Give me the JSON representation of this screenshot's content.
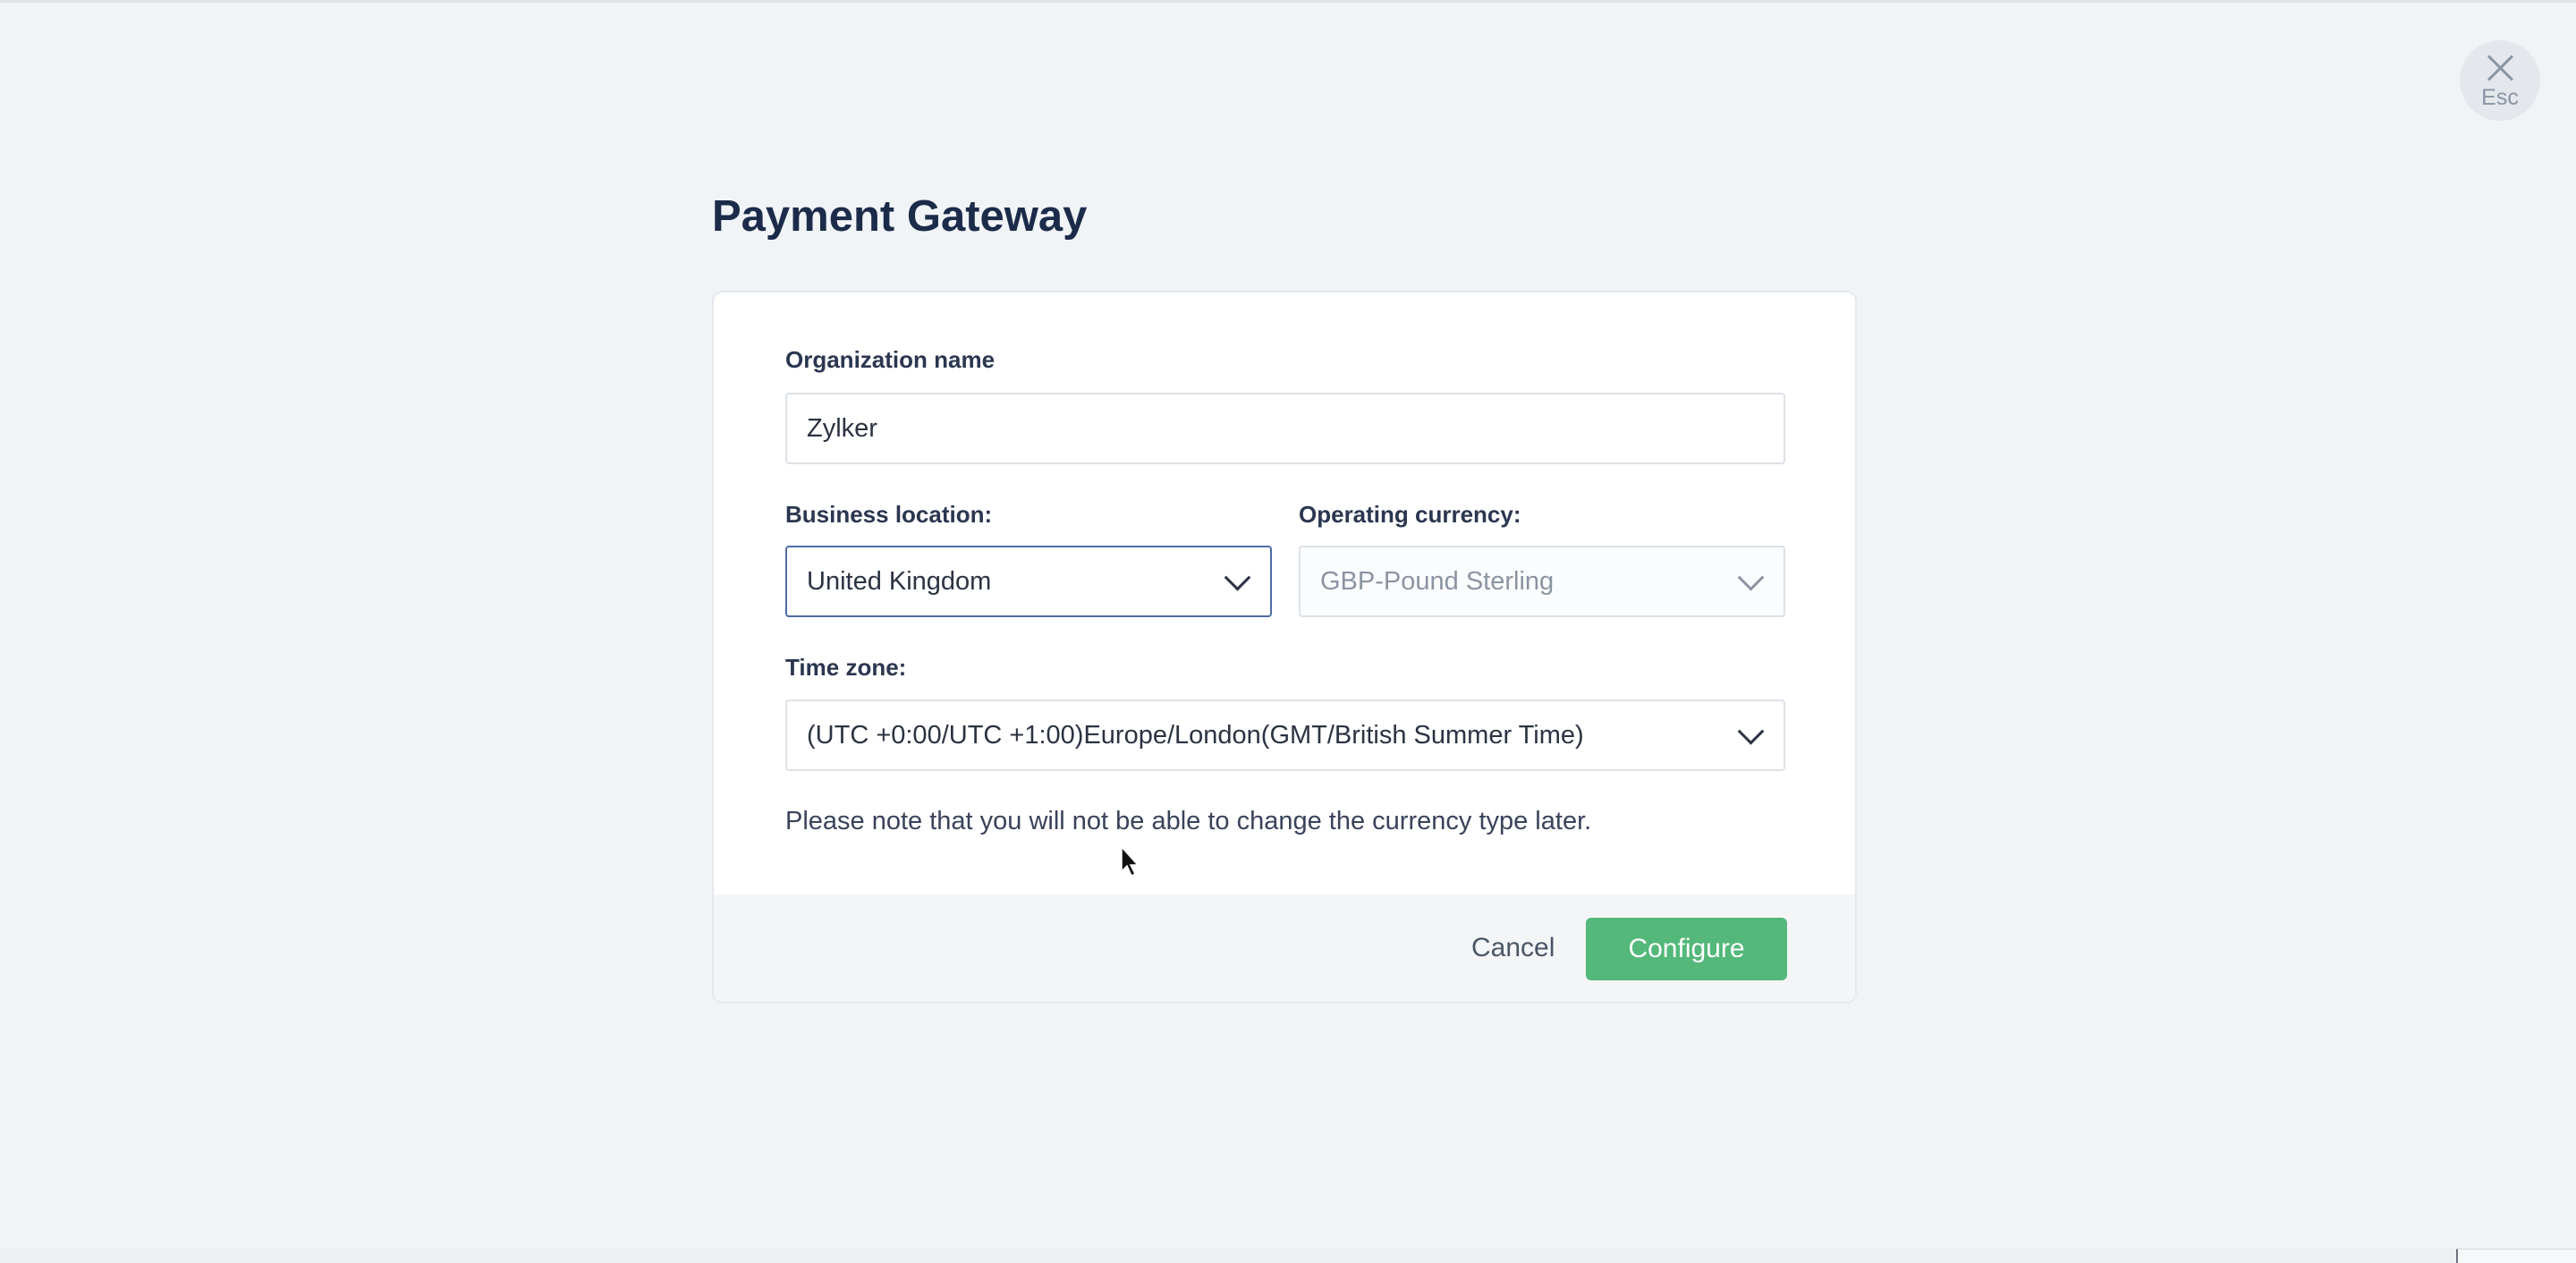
{
  "close": {
    "label": "Esc"
  },
  "page": {
    "title": "Payment Gateway"
  },
  "form": {
    "org_name": {
      "label": "Organization name",
      "value": "Zylker"
    },
    "business_location": {
      "label": "Business location:",
      "value": "United Kingdom"
    },
    "operating_currency": {
      "label": "Operating currency:",
      "value": "GBP-Pound Sterling"
    },
    "time_zone": {
      "label": "Time zone:",
      "value": "(UTC +0:00/UTC +1:00)Europe/London(GMT/British Summer Time)"
    },
    "note": "Please note that you will not be able to change the currency type later."
  },
  "footer": {
    "cancel_label": "Cancel",
    "configure_label": "Configure"
  },
  "colors": {
    "primary": "#53b87a",
    "focus_border": "#4d6ca3",
    "background": "#f1f4f6"
  },
  "icons": [
    "close-icon",
    "chevron-down-icon",
    "mouse-cursor-icon"
  ]
}
